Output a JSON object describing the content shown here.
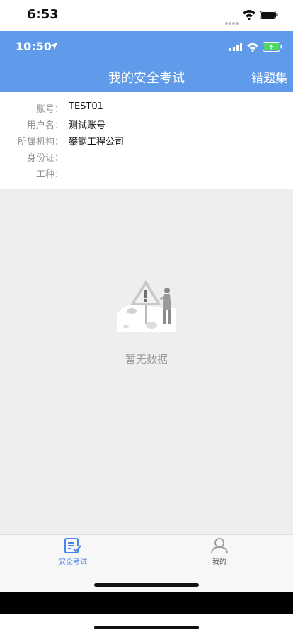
{
  "outer_status": {
    "time": "6:53"
  },
  "inner_status": {
    "time": "10:50"
  },
  "header": {
    "title": "我的安全考试",
    "action_label": "错题集"
  },
  "info": [
    {
      "label": "账号：",
      "value": "TEST01"
    },
    {
      "label": "用户名：",
      "value": "测试账号"
    },
    {
      "label": "所属机构：",
      "value": "攀钢工程公司"
    },
    {
      "label": "身份证：",
      "value": ""
    },
    {
      "label": "工种：",
      "value": ""
    }
  ],
  "empty_state": {
    "text": "暂无数据"
  },
  "tabs": [
    {
      "label": "安全考试",
      "icon": "exam-icon",
      "active": true
    },
    {
      "label": "我的",
      "icon": "user-icon",
      "active": false
    }
  ],
  "colors": {
    "header_bg": "#5f9bea",
    "active_tab": "#4a86e8",
    "content_bg": "#eceeef"
  }
}
